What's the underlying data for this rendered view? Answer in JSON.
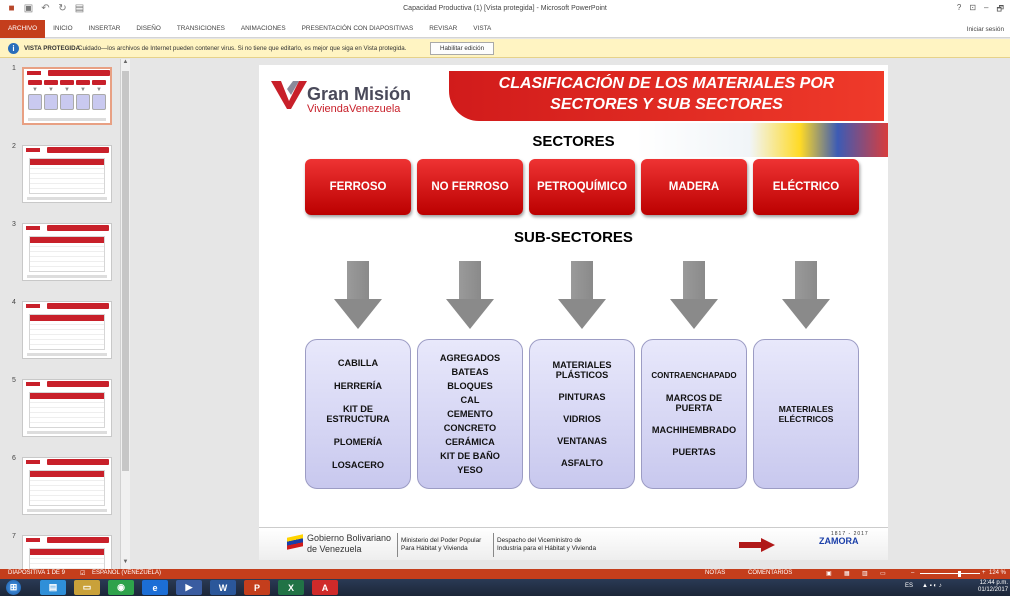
{
  "window": {
    "title": "Capacidad Productiva (1) [Vista protegida] - Microsoft PowerPoint",
    "controls": [
      "?",
      "⊡",
      "–",
      "🗗"
    ]
  },
  "ribbon": {
    "tabs": [
      "ARCHIVO",
      "INICIO",
      "INSERTAR",
      "DISEÑO",
      "TRANSICIONES",
      "ANIMACIONES",
      "PRESENTACIÓN CON DIAPOSITIVAS",
      "REVISAR",
      "VISTA"
    ],
    "active_tab": "ARCHIVO",
    "signin": "Iniciar sesión"
  },
  "protected_view": {
    "title": "VISTA PROTEGIDA",
    "message": "Cuidado—los archivos de Internet pueden contener virus. Si no tiene que editarlo, es mejor que siga en Vista protegida.",
    "enable_button": "Habilitar edición"
  },
  "thumbnails": {
    "numbers": [
      "1",
      "2",
      "3",
      "4",
      "5",
      "6",
      "7"
    ],
    "selected": 1
  },
  "slide": {
    "brand_line1": "Gran Misión",
    "brand_line2": "ViviendaVenezuela",
    "title_line1": "CLASIFICACIÓN DE LOS MATERIALES POR",
    "title_line2": "SECTORES Y SUB SECTORES",
    "sectores_header": "SECTORES",
    "subsectores_header": "SUB-SECTORES",
    "sectors": [
      "FERROSO",
      "NO FERROSO",
      "PETROQUÍMICO",
      "MADERA",
      "ELÉCTRICO"
    ],
    "subsectors": [
      [
        "CABILLA",
        "HERRERÍA",
        "KIT DE ESTRUCTURA",
        "PLOMERÍA",
        "LOSACERO"
      ],
      [
        "AGREGADOS",
        "BATEAS",
        "BLOQUES",
        "CAL",
        "CEMENTO",
        "CONCRETO",
        "CERÁMICA",
        "KIT DE BAÑO",
        "YESO"
      ],
      [
        "MATERIALES PLÁSTICOS",
        "PINTURAS",
        "VIDRIOS",
        "VENTANAS",
        "ASFALTO"
      ],
      [
        "CONTRAENCHAPADO",
        "MARCOS DE PUERTA",
        "MACHIHEMBRADO",
        "PUERTAS"
      ],
      [
        "MATERIALES ELÉCTRICOS"
      ]
    ],
    "footer": {
      "gob_line1": "Gobierno Bolivariano",
      "gob_line2": "de Venezuela",
      "ministry_line1": "Ministerio del Poder Popular",
      "ministry_line2": "Para Hábitat y Vivienda",
      "despacho_line1": "Despacho del Viceministro de",
      "despacho_line2": "Industria para el Hábitat y Vivienda",
      "zamora": "ZAMORA",
      "years": "1817 - 2017"
    }
  },
  "statusbar": {
    "slide_info": "DIAPOSITIVA 1 DE 9",
    "language": "ESPAÑOL (VENEZUELA)",
    "notes": "NOTAS",
    "comments": "COMENTARIOS",
    "zoom": "124 %"
  },
  "taskbar": {
    "lang": "ES",
    "time": "12:44 p.m.",
    "date": "01/12/2017"
  },
  "colors": {
    "accent": "#c43e1c",
    "sector_red": "#d11b1b",
    "sub_box": "#c8c8ee"
  }
}
